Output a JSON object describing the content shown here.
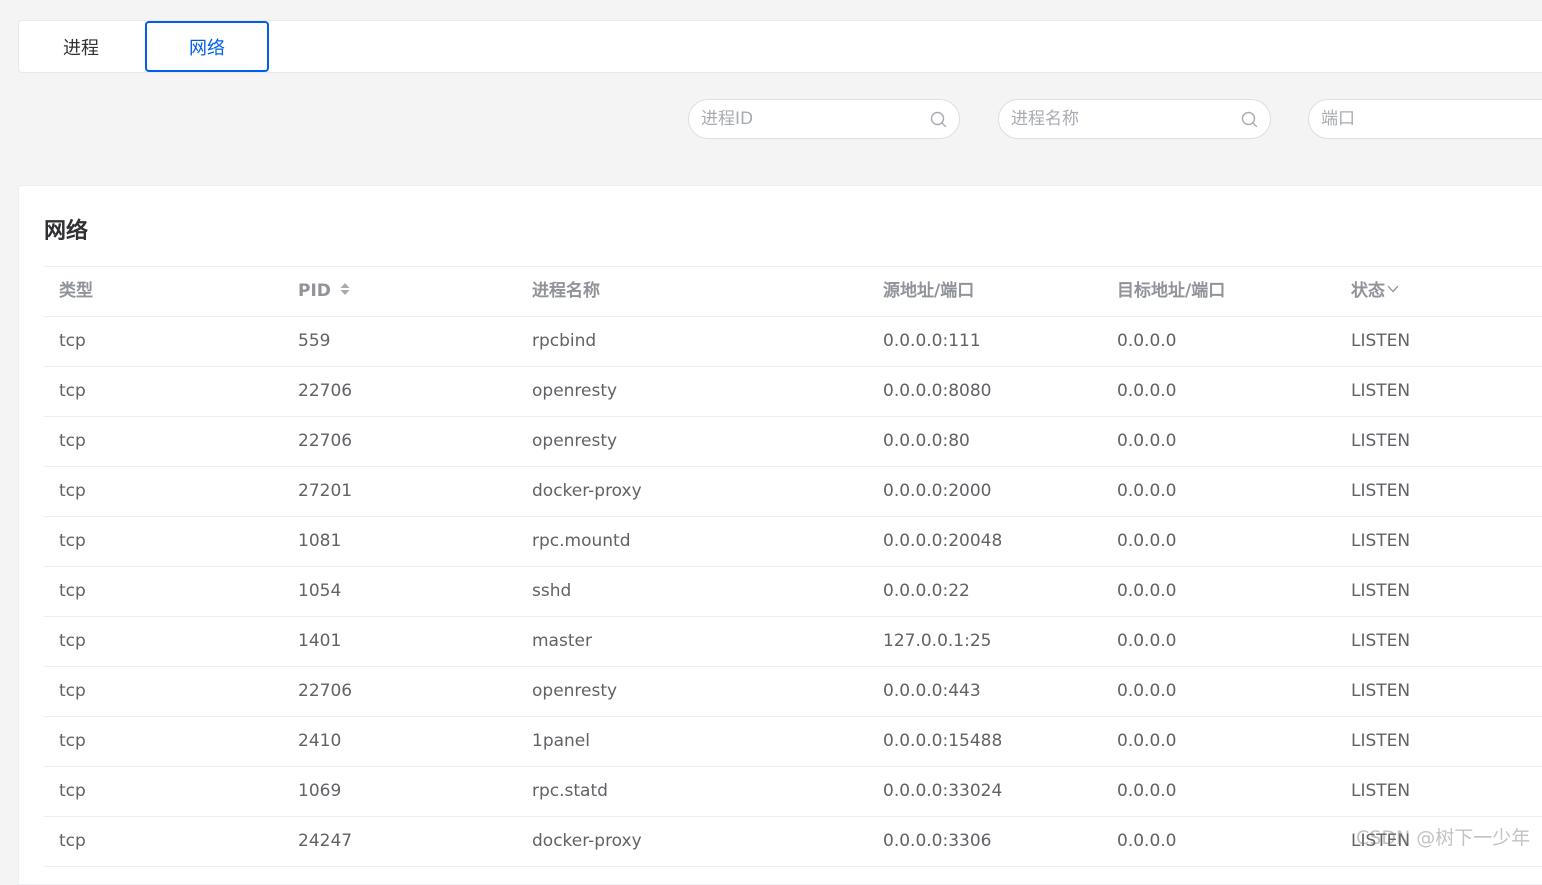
{
  "tabs": [
    {
      "label": "进程",
      "active": false
    },
    {
      "label": "网络",
      "active": true
    }
  ],
  "filters": {
    "pid_placeholder": "进程ID",
    "name_placeholder": "进程名称",
    "port_placeholder": "端口"
  },
  "card": {
    "title": "网络"
  },
  "table": {
    "headers": {
      "type": "类型",
      "pid": "PID",
      "name": "进程名称",
      "src": "源地址/端口",
      "dst": "目标地址/端口",
      "state": "状态"
    },
    "rows": [
      {
        "type": "tcp",
        "pid": "559",
        "name": "rpcbind",
        "src": "0.0.0.0:111",
        "dst": "0.0.0.0",
        "state": "LISTEN"
      },
      {
        "type": "tcp",
        "pid": "22706",
        "name": "openresty",
        "src": "0.0.0.0:8080",
        "dst": "0.0.0.0",
        "state": "LISTEN"
      },
      {
        "type": "tcp",
        "pid": "22706",
        "name": "openresty",
        "src": "0.0.0.0:80",
        "dst": "0.0.0.0",
        "state": "LISTEN"
      },
      {
        "type": "tcp",
        "pid": "27201",
        "name": "docker-proxy",
        "src": "0.0.0.0:2000",
        "dst": "0.0.0.0",
        "state": "LISTEN"
      },
      {
        "type": "tcp",
        "pid": "1081",
        "name": "rpc.mountd",
        "src": "0.0.0.0:20048",
        "dst": "0.0.0.0",
        "state": "LISTEN"
      },
      {
        "type": "tcp",
        "pid": "1054",
        "name": "sshd",
        "src": "0.0.0.0:22",
        "dst": "0.0.0.0",
        "state": "LISTEN"
      },
      {
        "type": "tcp",
        "pid": "1401",
        "name": "master",
        "src": "127.0.0.1:25",
        "dst": "0.0.0.0",
        "state": "LISTEN"
      },
      {
        "type": "tcp",
        "pid": "22706",
        "name": "openresty",
        "src": "0.0.0.0:443",
        "dst": "0.0.0.0",
        "state": "LISTEN"
      },
      {
        "type": "tcp",
        "pid": "2410",
        "name": "1panel",
        "src": "0.0.0.0:15488",
        "dst": "0.0.0.0",
        "state": "LISTEN"
      },
      {
        "type": "tcp",
        "pid": "1069",
        "name": "rpc.statd",
        "src": "0.0.0.0:33024",
        "dst": "0.0.0.0",
        "state": "LISTEN"
      },
      {
        "type": "tcp",
        "pid": "24247",
        "name": "docker-proxy",
        "src": "0.0.0.0:3306",
        "dst": "0.0.0.0",
        "state": "LISTEN"
      }
    ]
  },
  "watermark": "CSDN @树下一少年",
  "icons": {
    "search": "search-icon",
    "sort": "sort-icon",
    "filter": "chevron-down-icon"
  },
  "colors": {
    "accent": "#005eeb",
    "background": "#f4f4f5",
    "text": "#606266",
    "header_text": "#909399"
  }
}
